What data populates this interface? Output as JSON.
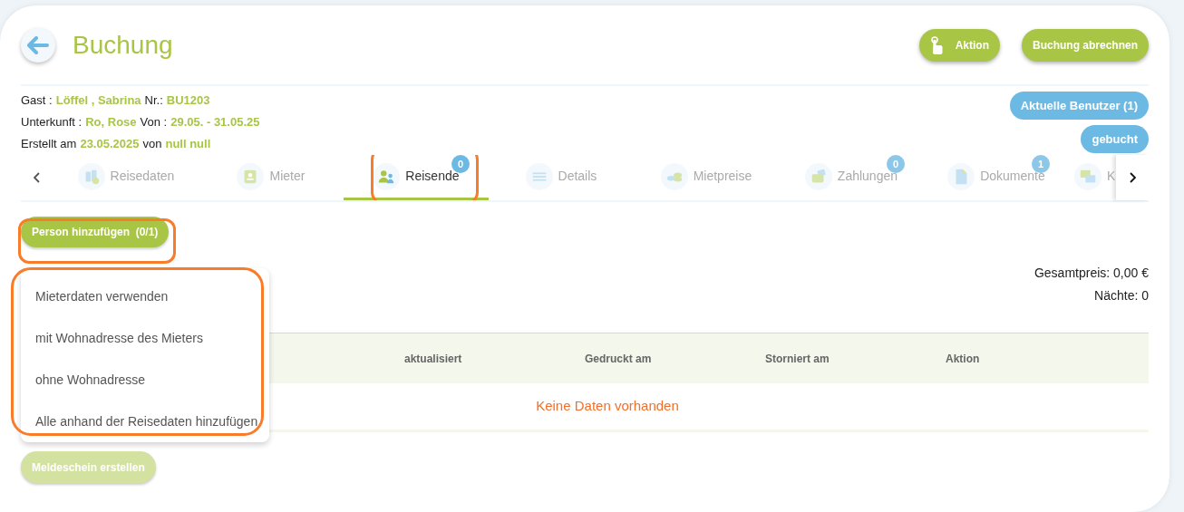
{
  "header": {
    "title": "Buchung",
    "buttons": [
      {
        "kind": "aktion",
        "label": "Aktion"
      },
      {
        "kind": "plain",
        "label": "Buchung abrechnen"
      }
    ]
  },
  "info": [
    {
      "parts": [
        {
          "text": "Gast :",
          "accent": false
        },
        {
          "text": "Löffel , Sabrina",
          "accent": true
        },
        {
          "text": "Nr.:",
          "accent": false
        },
        {
          "text": "BU1203",
          "accent": true
        }
      ]
    },
    {
      "parts": [
        {
          "text": "Unterkunft :",
          "accent": false
        },
        {
          "text": "Ro, Rose",
          "accent": true
        },
        {
          "text": "Von :",
          "accent": false
        },
        {
          "text": "29.05. - 31.05.25",
          "accent": true
        }
      ]
    },
    {
      "parts": [
        {
          "text": "Erstellt am",
          "accent": false
        },
        {
          "text": "23.05.2025",
          "accent": true
        },
        {
          "text": "von",
          "accent": false
        },
        {
          "text": "null null",
          "accent": true
        }
      ]
    }
  ],
  "status_badges": [
    "Aktuelle Benutzer (1)",
    "gebucht"
  ],
  "tabs": [
    {
      "kind": "reisedaten",
      "label": "Reisedaten",
      "selected": false,
      "highlighted": false
    },
    {
      "kind": "mieter",
      "label": "Mieter",
      "selected": false,
      "highlighted": false
    },
    {
      "kind": "reisende",
      "label": "Reisende",
      "selected": true,
      "badge": "0",
      "highlighted": true
    },
    {
      "kind": "details",
      "label": "Details",
      "selected": false,
      "highlighted": false
    },
    {
      "kind": "mietpreise",
      "label": "Mietpreise",
      "selected": false,
      "highlighted": false
    },
    {
      "kind": "zahlungen",
      "label": "Zahlungen",
      "selected": false,
      "badge": "0",
      "highlighted": false
    },
    {
      "kind": "dokumente",
      "label": "Dokumente",
      "selected": false,
      "badge": "1",
      "highlighted": false
    },
    {
      "kind": "chat",
      "label": "K",
      "selected": false,
      "highlighted": false
    }
  ],
  "add_button": {
    "label": "Person hinzufügen  (0/1)",
    "highlighted": true
  },
  "add_menu": {
    "highlighted": true,
    "items": [
      "Mieterdaten verwenden",
      "mit Wohnadresse des Mieters",
      "ohne Wohnadresse",
      "Alle anhand der Reisedaten hinzufügen"
    ]
  },
  "summary": [
    "Gesamtpreis: 0,00 €",
    "Nächte: 0"
  ],
  "table": {
    "columns": [
      "aktualisiert",
      "Gedruckt am",
      "Storniert am",
      "Aktion"
    ],
    "empty_text": "Keine Daten vorhanden"
  },
  "footer_button": {
    "label": "Meldeschein erstellen",
    "disabled": true
  }
}
